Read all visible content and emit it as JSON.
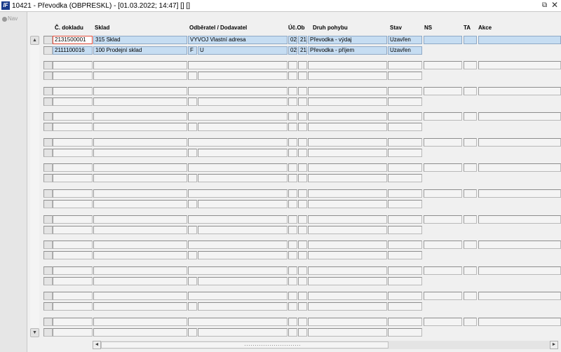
{
  "window": {
    "title": "10421 - Převodka (OBPRESKL) - [01.03.2022; 14:47] [] []",
    "app_icon": "IF",
    "restore_icon": "restore-icon",
    "close_icon": "close-icon"
  },
  "nav": {
    "label": "Nav",
    "icon": "nav-icon"
  },
  "columns": [
    {
      "key": "doc",
      "label": "Č. dokladu"
    },
    {
      "key": "sklad",
      "label": "Sklad"
    },
    {
      "key": "partner",
      "label": "Odběratel / Dodavatel"
    },
    {
      "key": "ucob",
      "label": "Úč.Ob"
    },
    {
      "key": "druh",
      "label": "Druh pohybu"
    },
    {
      "key": "stav",
      "label": "Stav"
    },
    {
      "key": "ns",
      "label": "NS"
    },
    {
      "key": "ta",
      "label": "TA"
    },
    {
      "key": "akce",
      "label": "Akce"
    }
  ],
  "records": [
    {
      "doc": "2131500001",
      "sklad": "315 Sklad",
      "partner": "VYVOJ Vlastní adresa",
      "uc": "02",
      "ob": "21",
      "druh": "Převodka - výdaj",
      "stav": "Uzavřen",
      "ns": "",
      "ta": "",
      "akce": ""
    },
    {
      "doc": "2111100016",
      "sklad": "100 Prodejní sklad",
      "partner_a": "F",
      "partner_b": "U",
      "uc": "02",
      "ob": "21",
      "druh": "Převodka - příjem",
      "stav": "Uzavřen"
    }
  ],
  "empty_record_groups": 11,
  "scrollbars": {
    "up_icon": "▲",
    "down_icon": "▼",
    "left_icon": "◄",
    "right_icon": "►"
  }
}
